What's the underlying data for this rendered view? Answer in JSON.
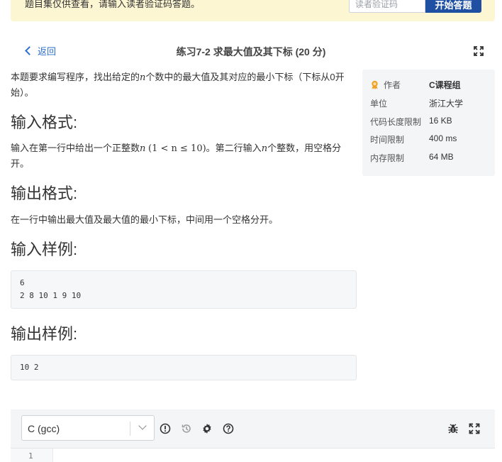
{
  "notice": {
    "text": "题目集仅供查看，请输入读者验证码答题。",
    "input_placeholder": "读者验证码",
    "button_label": "开始答题"
  },
  "header": {
    "back_label": "返回",
    "title": "练习7-2 求最大值及其下标 (20 分)"
  },
  "problem": {
    "intro_before": "本题要求编写程序，找出给定的",
    "intro_var": "n",
    "intro_after": "个数中的最大值及其对应的最小下标（下标从0开始）。",
    "input_heading": "输入格式:",
    "input_before": "输入在第一行中给出一个正整数",
    "input_var": "n",
    "input_math": "(1 < n ≤ 10)",
    "input_mid": "。第二行输入",
    "input_var2": "n",
    "input_after": "个整数，用空格分开。",
    "output_heading": "输出格式:",
    "output_text": "在一行中输出最大值及最大值的最小下标，中间用一个空格分开。",
    "sample_in_heading": "输入样例:",
    "sample_in_line1": "6",
    "sample_in_line2": "2 8 10 1 9 10",
    "sample_out_heading": "输出样例:",
    "sample_out": "10 2"
  },
  "info": {
    "author_label": "作者",
    "author_value": "C课程组",
    "unit_label": "单位",
    "unit_value": "浙江大学",
    "code_len_label": "代码长度限制",
    "code_len_value": "16 KB",
    "time_label": "时间限制",
    "time_value": "400 ms",
    "mem_label": "内存限制",
    "mem_value": "64 MB"
  },
  "editor": {
    "language": "C (gcc)",
    "line_number": "1",
    "icons": [
      "info-icon",
      "history-icon",
      "gear-icon",
      "help-icon",
      "bug-icon",
      "fullscreen-icon"
    ]
  },
  "colors": {
    "accent": "#1e4fa3",
    "link": "#2f6fd0",
    "notice_bg": "#fdf6d3",
    "award": "#f0a020"
  }
}
